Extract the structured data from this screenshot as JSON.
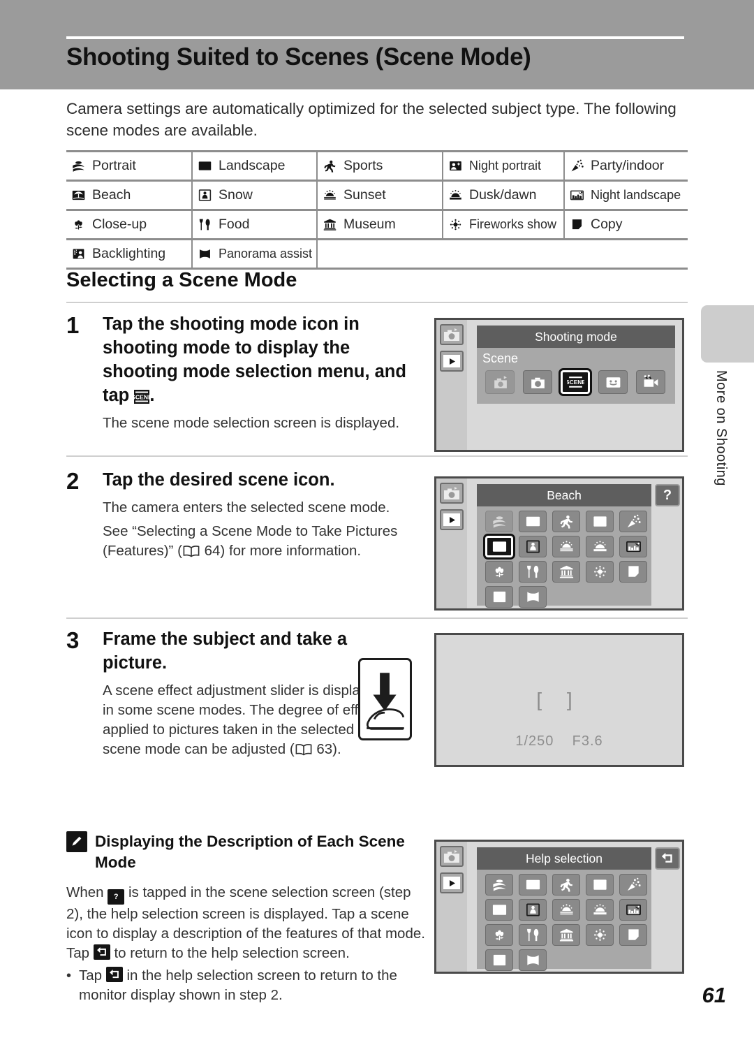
{
  "header": {
    "title": "Shooting Suited to Scenes (Scene Mode)"
  },
  "intro": "Camera settings are automatically optimized for the selected subject type. The following scene modes are available.",
  "scene_table": {
    "rows": [
      [
        {
          "icon": "portrait-icon",
          "label": "Portrait"
        },
        {
          "icon": "landscape-icon",
          "label": "Landscape"
        },
        {
          "icon": "sports-icon",
          "label": "Sports"
        },
        {
          "icon": "night-portrait-icon",
          "label": "Night portrait"
        },
        {
          "icon": "party-indoor-icon",
          "label": "Party/indoor"
        }
      ],
      [
        {
          "icon": "beach-icon",
          "label": "Beach"
        },
        {
          "icon": "snow-icon",
          "label": "Snow"
        },
        {
          "icon": "sunset-icon",
          "label": "Sunset"
        },
        {
          "icon": "dusk-dawn-icon",
          "label": "Dusk/dawn"
        },
        {
          "icon": "night-landscape-icon",
          "label": "Night landscape"
        }
      ],
      [
        {
          "icon": "close-up-icon",
          "label": "Close-up"
        },
        {
          "icon": "food-icon",
          "label": "Food"
        },
        {
          "icon": "museum-icon",
          "label": "Museum"
        },
        {
          "icon": "fireworks-icon",
          "label": "Fireworks show"
        },
        {
          "icon": "copy-icon",
          "label": "Copy"
        }
      ],
      [
        {
          "icon": "backlighting-icon",
          "label": "Backlighting"
        },
        {
          "icon": "panorama-assist-icon",
          "label": "Panorama assist"
        }
      ]
    ]
  },
  "section": {
    "heading": "Selecting a Scene Mode"
  },
  "steps": [
    {
      "number": "1",
      "title_part1": "Tap the shooting mode icon in shooting mode to display the shooting mode selection menu, and tap",
      "title_part2": ".",
      "body1": "The scene mode selection screen is displayed."
    },
    {
      "number": "2",
      "title": "Tap the desired scene icon.",
      "body1": "The camera enters the selected scene mode.",
      "body2_pre": "See “Selecting a Scene Mode to Take Pictures (Features)” (",
      "body2_page": "64",
      "body2_post": ") for more information."
    },
    {
      "number": "3",
      "title": "Frame the subject and take a picture.",
      "body1_pre": "A scene effect adjustment slider is displayed in some scene modes. The degree of effect applied to pictures taken in the selected scene mode can be adjusted (",
      "body1_page": "63",
      "body1_post": ")."
    }
  ],
  "screens": {
    "shooting_mode": {
      "title": "Shooting mode",
      "subtitle": "Scene",
      "tiles": [
        {
          "icon": "auto-scene-icon",
          "selected": false,
          "dim": true
        },
        {
          "icon": "camera-auto-icon",
          "selected": false,
          "dim": false
        },
        {
          "icon": "scene-icon",
          "selected": true,
          "dim": false
        },
        {
          "icon": "smile-icon",
          "selected": false,
          "dim": false
        },
        {
          "icon": "movie-icon",
          "selected": false,
          "dim": false
        }
      ]
    },
    "beach": {
      "title": "Beach",
      "help_button": "?",
      "tiles": [
        {
          "icon": "portrait-icon",
          "selected": false,
          "dim": true
        },
        {
          "icon": "landscape-icon",
          "selected": false,
          "dim": false
        },
        {
          "icon": "sports-icon",
          "selected": false,
          "dim": false
        },
        {
          "icon": "night-portrait-icon",
          "selected": false,
          "dim": false
        },
        {
          "icon": "party-indoor-icon",
          "selected": false,
          "dim": false
        },
        {
          "icon": "beach-icon",
          "selected": true,
          "dim": false
        },
        {
          "icon": "snow-icon",
          "selected": false,
          "dim": false
        },
        {
          "icon": "sunset-icon",
          "selected": false,
          "dim": false
        },
        {
          "icon": "dusk-dawn-icon",
          "selected": false,
          "dim": false
        },
        {
          "icon": "night-landscape-icon",
          "selected": false,
          "dim": false
        },
        {
          "icon": "close-up-icon",
          "selected": false,
          "dim": false
        },
        {
          "icon": "food-icon",
          "selected": false,
          "dim": false
        },
        {
          "icon": "museum-icon",
          "selected": false,
          "dim": false
        },
        {
          "icon": "fireworks-icon",
          "selected": false,
          "dim": false
        },
        {
          "icon": "copy-icon",
          "selected": false,
          "dim": false
        },
        {
          "icon": "backlighting-icon",
          "selected": false,
          "dim": false
        },
        {
          "icon": "panorama-assist-icon",
          "selected": false,
          "dim": false
        }
      ]
    },
    "viewfinder": {
      "brackets": "[ ]",
      "shutter_speed": "1/250",
      "aperture": "F3.6"
    },
    "help_selection": {
      "title": "Help selection",
      "back_button": "back-arrow-icon",
      "tiles": [
        {
          "icon": "portrait-icon"
        },
        {
          "icon": "landscape-icon"
        },
        {
          "icon": "sports-icon"
        },
        {
          "icon": "night-portrait-icon"
        },
        {
          "icon": "party-indoor-icon"
        },
        {
          "icon": "beach-icon"
        },
        {
          "icon": "snow-icon"
        },
        {
          "icon": "sunset-icon"
        },
        {
          "icon": "dusk-dawn-icon"
        },
        {
          "icon": "night-landscape-icon"
        },
        {
          "icon": "close-up-icon"
        },
        {
          "icon": "food-icon"
        },
        {
          "icon": "museum-icon"
        },
        {
          "icon": "fireworks-icon"
        },
        {
          "icon": "copy-icon"
        },
        {
          "icon": "backlighting-icon"
        },
        {
          "icon": "panorama-assist-icon"
        }
      ]
    }
  },
  "note": {
    "title": "Displaying the Description of Each Scene Mode",
    "body_p1": "When",
    "body_p2": "is tapped in the scene selection screen (step 2), the help selection screen is displayed. Tap a scene icon to display a description of the features of that mode. Tap",
    "body_p3": "to return to the help selection screen.",
    "bullet_dot": "•",
    "bullet_p1": "Tap",
    "bullet_p2": "in the help selection screen to return to the monitor display shown in step 2."
  },
  "margin_tab": {
    "label": "More on Shooting"
  },
  "page_number": "61",
  "colors": {
    "header_band": "#9b9b9b",
    "table_rule": "#8d8d8d",
    "monitor_bg": "#d9d9d9",
    "titlebar": "#5e5e5e",
    "tile": "#8a8a8a",
    "selected_tile": "#141414",
    "margin_tab": "#cdcdcd"
  }
}
